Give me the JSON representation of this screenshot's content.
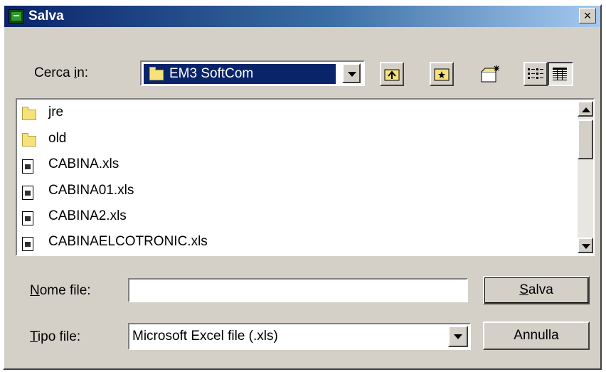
{
  "dialog": {
    "title": "Salva",
    "close_glyph": "×"
  },
  "lookin": {
    "label_pre": "Cerca ",
    "label_u": "i",
    "label_post": "n:",
    "value": "EM3 SoftCom",
    "icon": "folder-icon"
  },
  "toolbar": {
    "up_icon": "up-folder-icon",
    "home_icon": "home-folder-icon",
    "new_folder_icon": "new-folder-icon",
    "list_view_icon": "list-view-icon",
    "details_view_icon": "details-view-icon"
  },
  "files": [
    {
      "name": "jre",
      "type": "folder"
    },
    {
      "name": "old",
      "type": "folder"
    },
    {
      "name": "CABINA.xls",
      "type": "xls"
    },
    {
      "name": "CABINA01.xls",
      "type": "xls"
    },
    {
      "name": "CABINA2.xls",
      "type": "xls"
    },
    {
      "name": "CABINAELCOTRONIC.xls",
      "type": "xls"
    }
  ],
  "filename": {
    "label_u": "N",
    "label_post": "ome file:",
    "value": ""
  },
  "filetype": {
    "label_u": "T",
    "label_post": "ipo file:",
    "value": "Microsoft Excel file (.xls)"
  },
  "buttons": {
    "save_u": "S",
    "save_post": "alva",
    "cancel": "Annulla"
  },
  "colors": {
    "title_start": "#0a246a",
    "title_end": "#a6caf0",
    "face": "#d4d0c8",
    "selection": "#0a246a"
  }
}
